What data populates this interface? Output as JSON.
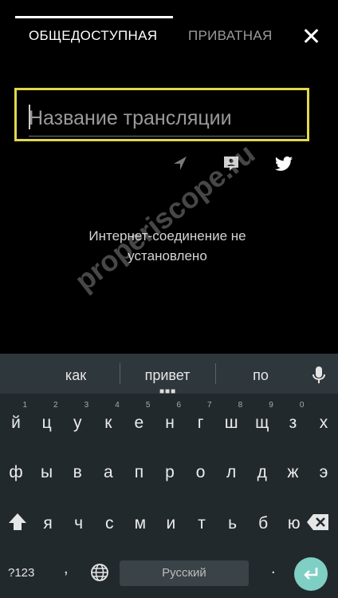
{
  "tabs": {
    "public_label": "ОБЩЕДОСТУПНАЯ",
    "private_label": "ПРИВАТНАЯ"
  },
  "broadcast": {
    "title_placeholder": "Название трансляции",
    "title_value": ""
  },
  "share_icons": [
    "location-icon",
    "chat-icon",
    "twitter-icon"
  ],
  "status": {
    "message": "Интернет-соединение не установлено"
  },
  "watermark": "properiscope.ru",
  "keyboard": {
    "suggestions": [
      "как",
      "привет",
      "по"
    ],
    "rows": [
      [
        {
          "key": "й",
          "hint": "1"
        },
        {
          "key": "ц",
          "hint": "2"
        },
        {
          "key": "у",
          "hint": "3"
        },
        {
          "key": "к",
          "hint": "4"
        },
        {
          "key": "е",
          "hint": "5"
        },
        {
          "key": "н",
          "hint": "6"
        },
        {
          "key": "г",
          "hint": "7"
        },
        {
          "key": "ш",
          "hint": "8"
        },
        {
          "key": "щ",
          "hint": "9"
        },
        {
          "key": "з",
          "hint": "0"
        },
        {
          "key": "х",
          "hint": ""
        }
      ],
      [
        {
          "key": "ф",
          "hint": ""
        },
        {
          "key": "ы",
          "hint": ""
        },
        {
          "key": "в",
          "hint": ""
        },
        {
          "key": "а",
          "hint": ""
        },
        {
          "key": "п",
          "hint": ""
        },
        {
          "key": "р",
          "hint": ""
        },
        {
          "key": "о",
          "hint": ""
        },
        {
          "key": "л",
          "hint": ""
        },
        {
          "key": "д",
          "hint": ""
        },
        {
          "key": "ж",
          "hint": ""
        },
        {
          "key": "э",
          "hint": ""
        }
      ],
      [
        {
          "key": "я",
          "hint": ""
        },
        {
          "key": "ч",
          "hint": ""
        },
        {
          "key": "с",
          "hint": ""
        },
        {
          "key": "м",
          "hint": ""
        },
        {
          "key": "и",
          "hint": ""
        },
        {
          "key": "т",
          "hint": ""
        },
        {
          "key": "ь",
          "hint": ""
        },
        {
          "key": "б",
          "hint": ""
        },
        {
          "key": "ю",
          "hint": ""
        }
      ]
    ],
    "symbols_label": "?123",
    "comma": ",",
    "space_label": "Русский",
    "period": "."
  },
  "colors": {
    "accent_border": "#e1d84d",
    "keyboard_bg": "#22292d",
    "enter_button": "#7fcfc4"
  }
}
